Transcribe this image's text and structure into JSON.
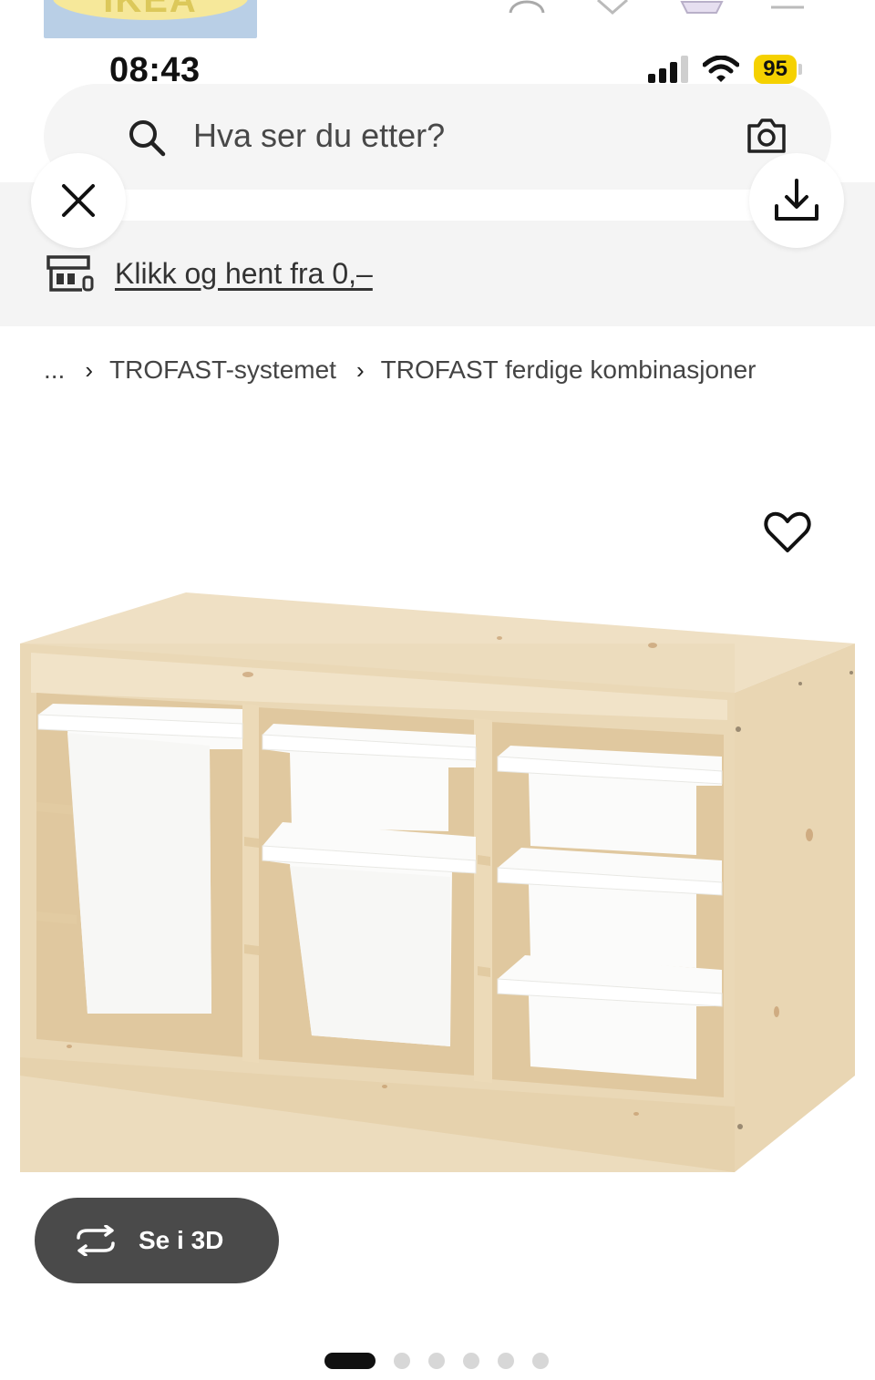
{
  "header": {
    "logo_text": "IKEA"
  },
  "status_bar": {
    "time": "08:43",
    "battery": "95"
  },
  "search": {
    "placeholder": "Hva ser du etter?"
  },
  "click_collect": {
    "label": "Klikk og hent fra 0,–"
  },
  "breadcrumb": {
    "items": [
      "...",
      "TROFAST-systemet",
      "TROFAST ferdige kombinasjoner"
    ]
  },
  "product": {
    "view_3d_label": "Se i 3D",
    "carousel": {
      "total": 6,
      "active": 1
    }
  },
  "colors": {
    "accent_battery": "#f5d100",
    "button_dark": "#4a4a4a",
    "wood": "#ead8b7"
  }
}
